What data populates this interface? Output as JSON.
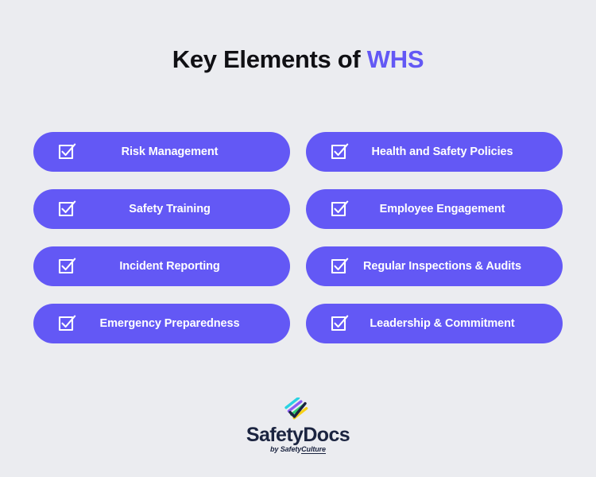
{
  "page": {
    "background_color": "#ebecf0",
    "accent_color": "#6358f5"
  },
  "title": {
    "lead": "Key Elements of ",
    "accent": "WHS"
  },
  "items": [
    {
      "label": "Risk Management",
      "icon": "checkbox-checked-icon",
      "column": "left"
    },
    {
      "label": "Health and Safety Policies",
      "icon": "checkbox-checked-icon",
      "column": "right"
    },
    {
      "label": "Safety Training",
      "icon": "checkbox-checked-icon",
      "column": "left"
    },
    {
      "label": "Employee Engagement",
      "icon": "checkbox-checked-icon",
      "column": "right"
    },
    {
      "label": "Incident Reporting",
      "icon": "checkbox-checked-icon",
      "column": "left"
    },
    {
      "label": "Regular Inspections & Audits",
      "icon": "checkbox-checked-icon",
      "column": "right"
    },
    {
      "label": "Emergency Preparedness",
      "icon": "checkbox-checked-icon",
      "column": "left"
    },
    {
      "label": "Leadership & Commitment",
      "icon": "checkbox-checked-icon",
      "column": "right"
    }
  ],
  "footer": {
    "logo_mark": "safetydocs-diamond-icon",
    "wordmark": "SafetyDocs",
    "byline_lead": "by Safety",
    "byline_accent": "Culture",
    "mark_colors": {
      "cyan": "#2ad2e2",
      "purple": "#8b5cf6",
      "green": "#2ecc71",
      "yellow": "#f7d117",
      "dark": "#1b2440"
    },
    "wordmark_color": "#1b2440"
  }
}
